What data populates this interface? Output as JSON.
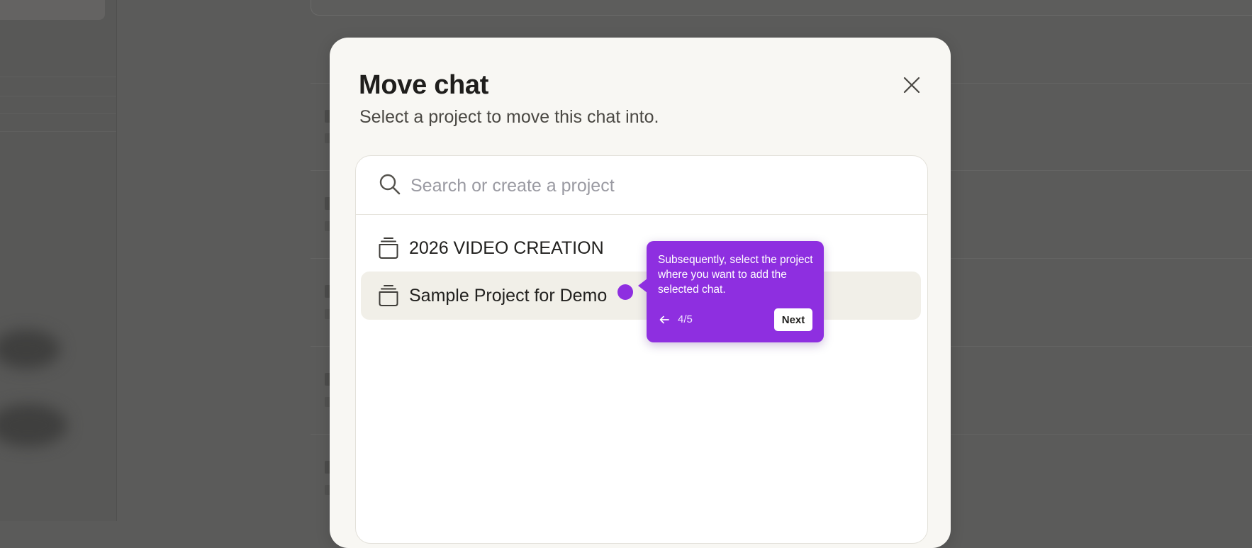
{
  "modal": {
    "title": "Move chat",
    "subtitle": "Select a project to move this chat into."
  },
  "search": {
    "placeholder": "Search or create a project",
    "value": ""
  },
  "projects": [
    {
      "label": "2026 VIDEO CREATION",
      "icon": "project-stack-icon",
      "selected": false
    },
    {
      "label": "Sample Project for Demo",
      "icon": "project-stack-icon",
      "selected": true
    }
  ],
  "tour": {
    "text": "Subsequently, select the project where you want to add the selected chat.",
    "step": "4/5",
    "next_label": "Next",
    "back_icon": "arrow-left-icon"
  },
  "colors": {
    "overlay": "#5b5b5a",
    "modal_bg": "#f8f7f3",
    "selected_row": "#f1efe8",
    "tour_accent": "#8e2fe0"
  }
}
